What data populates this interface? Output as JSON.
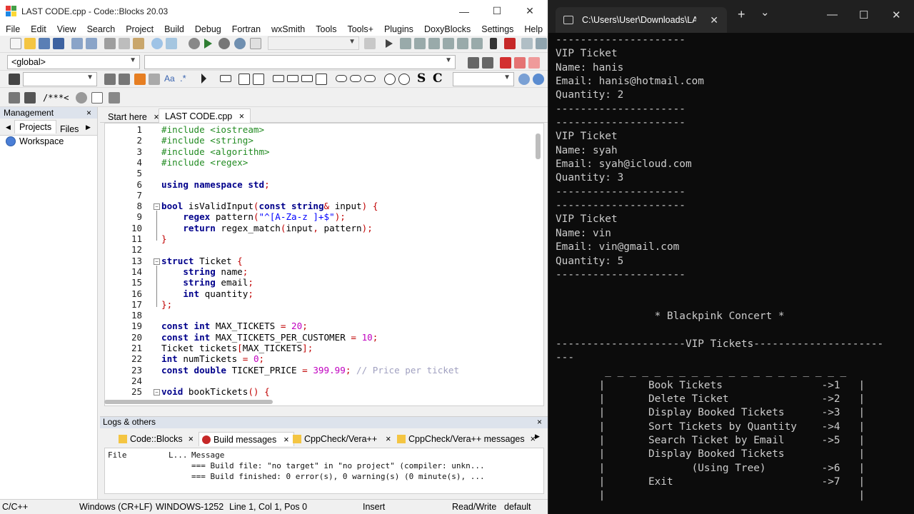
{
  "ide": {
    "title": "LAST CODE.cpp - Code::Blocks 20.03",
    "window_controls": {
      "minimize": "—",
      "maximize": "☐",
      "close": "✕"
    },
    "menu": [
      "File",
      "Edit",
      "View",
      "Search",
      "Project",
      "Build",
      "Debug",
      "Fortran",
      "wxSmith",
      "Tools",
      "Tools+",
      "Plugins",
      "DoxyBlocks",
      "Settings",
      "Help"
    ],
    "scope_combo": "<global>",
    "toolbar_symbols": {
      "comment_block": "/**",
      "comment_line": "*<",
      "regex": ".*",
      "match_case": "Aa",
      "bold_s": "S",
      "bold_c": "C"
    },
    "management": {
      "title": "Management",
      "close": "×",
      "tabs": [
        "Projects",
        "Files"
      ],
      "workspace": "Workspace"
    },
    "editor_tabs": [
      {
        "label": "Start here",
        "close": "×"
      },
      {
        "label": "LAST CODE.cpp",
        "close": "×"
      }
    ],
    "line_numbers": [
      "1",
      "2",
      "3",
      "4",
      "5",
      "6",
      "7",
      "8",
      "9",
      "10",
      "11",
      "12",
      "13",
      "14",
      "15",
      "16",
      "17",
      "18",
      "19",
      "20",
      "21",
      "22",
      "23",
      "24",
      "25"
    ],
    "logs": {
      "title": "Logs & others",
      "close": "×",
      "tabs": [
        {
          "label": "Code::Blocks",
          "close": "×"
        },
        {
          "label": "Build messages",
          "close": "×"
        },
        {
          "label": "CppCheck/Vera++",
          "close": "×"
        },
        {
          "label": "CppCheck/Vera++ messages",
          "close": "×"
        }
      ],
      "columns": [
        "File",
        "L...",
        "Message"
      ],
      "messages": [
        "=== Build file: \"no target\" in \"no project\" (compiler: unkn...",
        "=== Build finished: 0 error(s), 0 warning(s) (0 minute(s), ..."
      ]
    },
    "status": {
      "language": "C/C++",
      "line_endings": "Windows (CR+LF)",
      "encoding": "WINDOWS-1252",
      "position": "Line 1, Col 1, Pos 0",
      "mode": "Insert",
      "access": "Read/Write",
      "profile": "default"
    }
  },
  "terminal": {
    "tab_title": "C:\\Users\\User\\Downloads\\LA",
    "tab_close": "✕",
    "new_tab": "+",
    "dropdown": "⌄",
    "controls": {
      "minimize": "—",
      "maximize": "☐",
      "close": "✕"
    },
    "lines": [
      "---------------------",
      "VIP Ticket",
      "Name: hanis",
      "Email: hanis@hotmail.com",
      "Quantity: 2",
      "---------------------",
      "---------------------",
      "VIP Ticket",
      "Name: syah",
      "Email: syah@icloud.com",
      "Quantity: 3",
      "---------------------",
      "---------------------",
      "VIP Ticket",
      "Name: vin",
      "Email: vin@gmail.com",
      "Quantity: 5",
      "---------------------",
      "",
      "",
      "                * Blackpink Concert *",
      "",
      "---------------------VIP Tickets---------------------",
      "---",
      "        _ _ _ _ _ _ _ _ _ _ _ _ _ _ _ _ _ _ _ _",
      "       |       Book Tickets                ->1   |",
      "       |       Delete Ticket               ->2   |",
      "       |       Display Booked Tickets      ->3   |",
      "       |       Sort Tickets by Quantity    ->4   |",
      "       |       Search Ticket by Email      ->5   |",
      "       |       Display Booked Tickets            |",
      "       |              (Using Tree)         ->6   |",
      "       |       Exit                        ->7   |",
      "       |                                         |"
    ]
  }
}
